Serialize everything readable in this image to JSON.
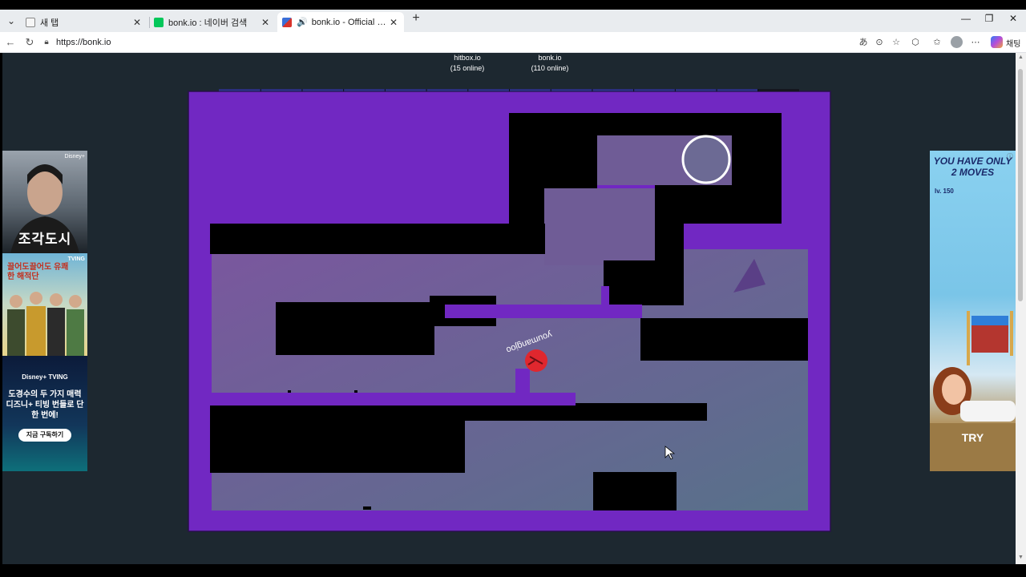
{
  "browser": {
    "tabs": [
      {
        "label": "새 탭",
        "active": false,
        "close": "✕"
      },
      {
        "label": "bonk.io : 네이버 검색",
        "active": false,
        "close": "✕"
      },
      {
        "label": "bonk.io - Official Site: Play Bonk",
        "active": true,
        "close": "✕"
      }
    ],
    "new_tab_icon": "plus-icon",
    "url": "https://bonk.io",
    "profile_label": "채팅",
    "window_controls": [
      "minimize-icon",
      "maximize-icon",
      "close-icon"
    ]
  },
  "servers": [
    {
      "name": "hitbox.io",
      "online": "(15 online)"
    },
    {
      "name": "bonk.io",
      "online": "(110 online)"
    }
  ],
  "game": {
    "player_name": "youmangjoo",
    "colors": {
      "border": "#7128c2",
      "floor": "#6e5b9c",
      "wall": "#000000",
      "player": "#e0272e",
      "background": "#1d2830"
    },
    "timer_segments": 14
  },
  "left_ad": {
    "top_title": "조각도시",
    "top_badge": "Disney+",
    "middle_text": "끌어도끌어도 유쾌한 해적단",
    "middle_badge": "TVING",
    "bottom_logos": "Disney+  TVING",
    "bottom_headline": "도경수의 두 가지 매력 디즈니+ 티빙 번들로 단 한 번에!",
    "cta": "지금 구독하기"
  },
  "right_ad": {
    "headline": "YOU HAVE ONLY 2 MOVES",
    "level": "lv. 150",
    "cta": "TRY"
  }
}
